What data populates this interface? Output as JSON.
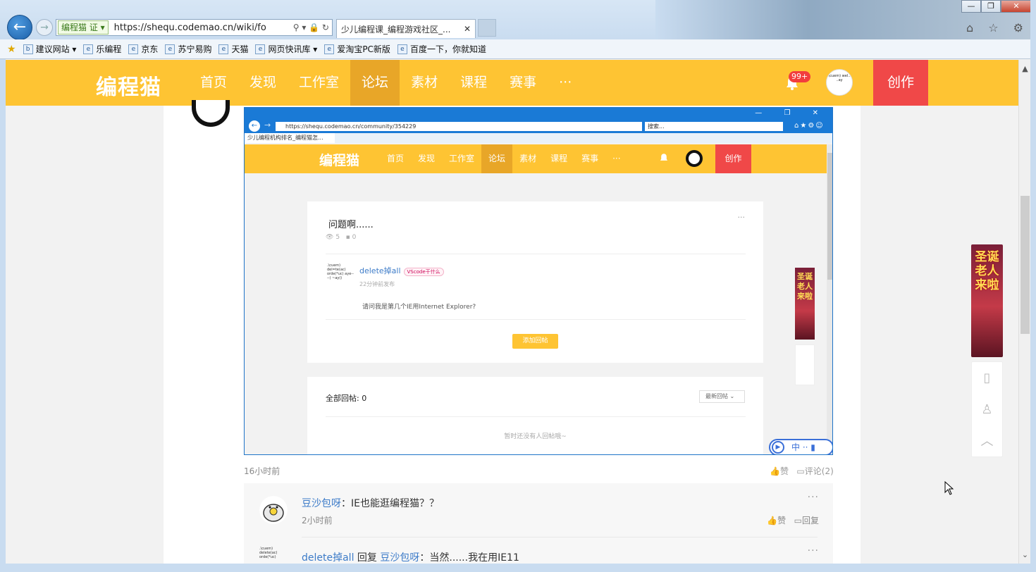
{
  "browser": {
    "site_badge": "编程猫 证 ▾",
    "url": "https://shequ.codemao.cn/wiki/fo",
    "tab_title": "少儿编程课_编程游戏社区_...",
    "window_buttons": [
      "—",
      "❐",
      "✕"
    ],
    "right_icons": "⌂ ☆ ⚙",
    "favorites": [
      {
        "label": "建议网站 ▾",
        "icon": "bing-icon"
      },
      {
        "label": "乐编程",
        "icon": "ie-page-icon"
      },
      {
        "label": "京东",
        "icon": "ie-page-icon"
      },
      {
        "label": "苏宁易购",
        "icon": "ie-page-icon"
      },
      {
        "label": "天猫",
        "icon": "ie-page-icon"
      },
      {
        "label": "网页快讯库 ▾",
        "icon": "ie-page-icon"
      },
      {
        "label": "爱淘宝PC新版",
        "icon": "ie-page-icon"
      },
      {
        "label": "百度一下，你就知道",
        "icon": "ie-page-icon"
      }
    ]
  },
  "site": {
    "logo": "编程猫",
    "nav": [
      "首页",
      "发现",
      "工作室",
      "论坛",
      "素材",
      "课程",
      "赛事",
      "···"
    ],
    "active_nav": "论坛",
    "notif_badge": "99+",
    "create": "创作",
    "brand_color": "#fec433"
  },
  "embedded": {
    "url": "https://shequ.codemao.cn/community/354229",
    "search": "搜索...",
    "tab": "少儿编程机构排名_编程猫怎...",
    "logo": "编程猫",
    "nav": [
      "首页",
      "发现",
      "工作室",
      "论坛",
      "素材",
      "课程",
      "赛事",
      "···"
    ],
    "create": "创作",
    "question": "问题啊......",
    "views": "5",
    "comments": "0",
    "reply_name": "delete掉all",
    "reply_tag": "VScode干什么",
    "reply_time": "22分钟前发布",
    "reply_text": "请问我是第几个IE用Internet Explorer?",
    "add_reply": "添加回帖",
    "all_replies": "全部回帖: 0",
    "sort": "最新回帖",
    "empty": "暂时还没有人回帖哦~",
    "ad_text": "圣诞老人来啦",
    "ime": "中"
  },
  "post": {
    "time": "16小时前",
    "like": "赞",
    "comment": "评论(2)"
  },
  "comments": [
    {
      "name": "豆沙包呀",
      "text": "：IE也能逛编程猫？？",
      "time": "2小时前",
      "like": "赞",
      "reply": "回复"
    },
    {
      "name": "delete掉all",
      "mid": " 回复 ",
      "target": "豆沙包呀",
      "text": "：当然......我在用IE11"
    }
  ],
  "ad_text": "圣诞老人来啦"
}
